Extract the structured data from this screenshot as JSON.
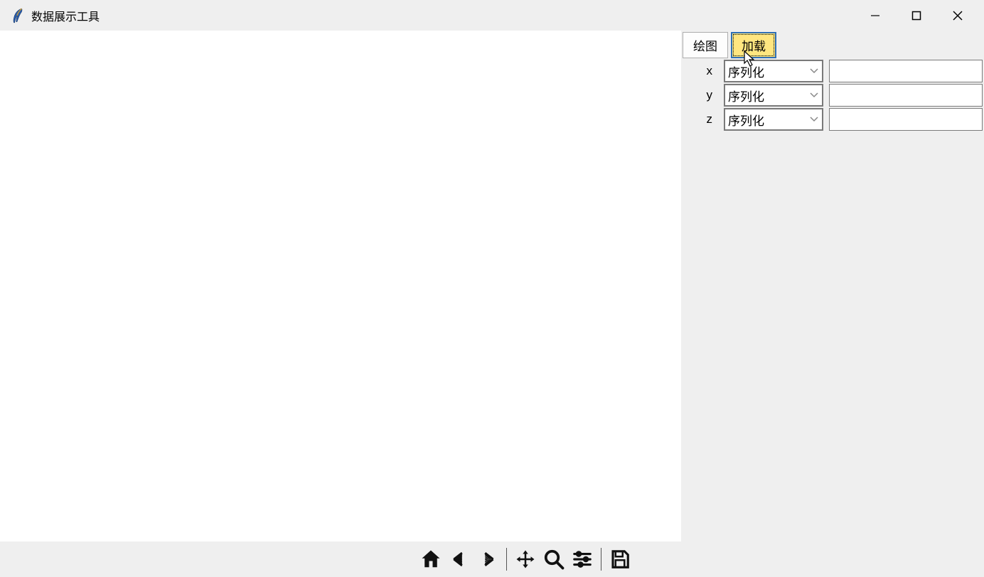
{
  "window": {
    "title": "数据展示工具"
  },
  "buttons": {
    "plot": "绘图",
    "load": "加载"
  },
  "axes": {
    "x": {
      "label": "x",
      "combo": "序列化",
      "entry": ""
    },
    "y": {
      "label": "y",
      "combo": "序列化",
      "entry": ""
    },
    "z": {
      "label": "z",
      "combo": "序列化",
      "entry": ""
    }
  },
  "toolbar": {
    "icons": [
      "home",
      "back",
      "forward",
      "pan",
      "zoom",
      "config",
      "save"
    ]
  }
}
